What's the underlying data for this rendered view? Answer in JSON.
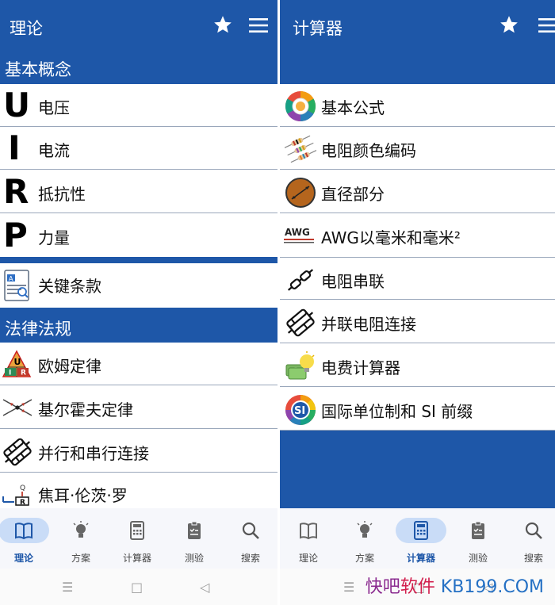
{
  "left": {
    "title": "理论",
    "sections": [
      {
        "heading": "基本概念"
      },
      {
        "heading": "法律法规"
      }
    ],
    "items": [
      {
        "letter": "U",
        "label": "电压"
      },
      {
        "letter": "I",
        "label": "电流"
      },
      {
        "letter": "R",
        "label": "抵抗性"
      },
      {
        "letter": "P",
        "label": "力量"
      },
      {
        "label": "关键条款"
      },
      {
        "label": "欧姆定律",
        "badge": [
          "U",
          "I",
          "R"
        ]
      },
      {
        "label": "基尔霍夫定律"
      },
      {
        "label": "并行和串行连接"
      },
      {
        "label": "焦耳·伦茨·罗",
        "badge": [
          "Q",
          "R"
        ]
      }
    ]
  },
  "right": {
    "title": "计算器",
    "items": [
      {
        "label": "基本公式"
      },
      {
        "label": "电阻颜色编码"
      },
      {
        "label": "直径部分"
      },
      {
        "label": "AWG以毫米和毫米²",
        "badge": "AWG"
      },
      {
        "label": "电阻串联"
      },
      {
        "label": "并联电阻连接"
      },
      {
        "label": "电费计算器"
      },
      {
        "label": "国际单位制和 SI 前缀",
        "badge": "SI"
      }
    ]
  },
  "nav": {
    "left": [
      "理论",
      "方案",
      "计算器",
      "测验",
      "搜索"
    ],
    "right": [
      "理论",
      "方案",
      "计算器",
      "测验",
      "搜索"
    ]
  },
  "watermark": {
    "a": "快吧",
    "b": "软件",
    "c": "KB199.COM"
  },
  "colors": {
    "primary": "#1e57a8",
    "active_pill": "#c9dcf7"
  }
}
